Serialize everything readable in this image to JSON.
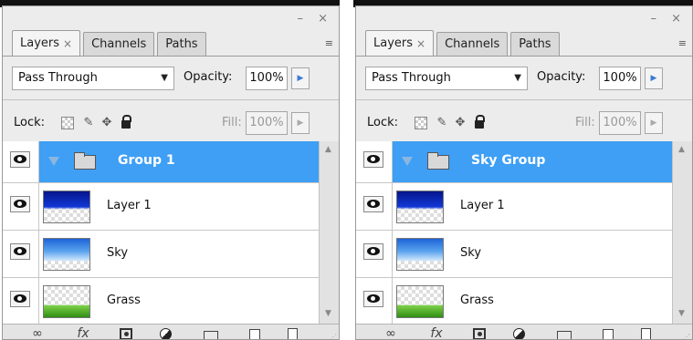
{
  "panels": [
    {
      "window_controls": "– ×",
      "tabs": [
        {
          "label": "Layers",
          "close": "×"
        },
        {
          "label": "Channels"
        },
        {
          "label": "Paths"
        }
      ],
      "panel_menu_icon": "≡",
      "blend_mode": "Pass Through",
      "opacity_label": "Opacity:",
      "opacity_value": "100%",
      "lock_label": "Lock:",
      "fill_label": "Fill:",
      "fill_value": "100%",
      "group_name": "Group 1",
      "layers": [
        {
          "name": "Layer 1",
          "thumbnail": "blue-gradient-thumbnail"
        },
        {
          "name": "Sky",
          "thumbnail": "sky-thumbnail"
        },
        {
          "name": "Grass",
          "thumbnail": "grass-thumbnail"
        }
      ],
      "footer_icons": [
        "link-icon",
        "fx-icon",
        "mask-icon",
        "adjustment-icon",
        "folder-icon",
        "new-layer-icon",
        "trash-icon"
      ]
    },
    {
      "window_controls": "– ×",
      "tabs": [
        {
          "label": "Layers",
          "close": "×"
        },
        {
          "label": "Channels"
        },
        {
          "label": "Paths"
        }
      ],
      "panel_menu_icon": "≡",
      "blend_mode": "Pass Through",
      "opacity_label": "Opacity:",
      "opacity_value": "100%",
      "lock_label": "Lock:",
      "fill_label": "Fill:",
      "fill_value": "100%",
      "group_name": "Sky Group",
      "layers": [
        {
          "name": "Layer 1",
          "thumbnail": "blue-gradient-thumbnail"
        },
        {
          "name": "Sky",
          "thumbnail": "sky-thumbnail"
        },
        {
          "name": "Grass",
          "thumbnail": "grass-thumbnail"
        }
      ],
      "footer_icons": [
        "link-icon",
        "fx-icon",
        "mask-icon",
        "adjustment-icon",
        "folder-icon",
        "new-layer-icon",
        "trash-icon"
      ]
    }
  ],
  "symbols": {
    "dropdown_arrow": "▼",
    "stepper_arrow": "▶",
    "scroll_up": "▲",
    "scroll_down": "▼",
    "move_glyph": "✥",
    "brush_glyph": "✎",
    "link_glyph": "∞",
    "fx_glyph": "fx",
    "grip_glyph": "⋰"
  },
  "colors": {
    "selection": "#3e9ff5",
    "panel_bg": "#ececec",
    "top_strip": "#111111"
  }
}
